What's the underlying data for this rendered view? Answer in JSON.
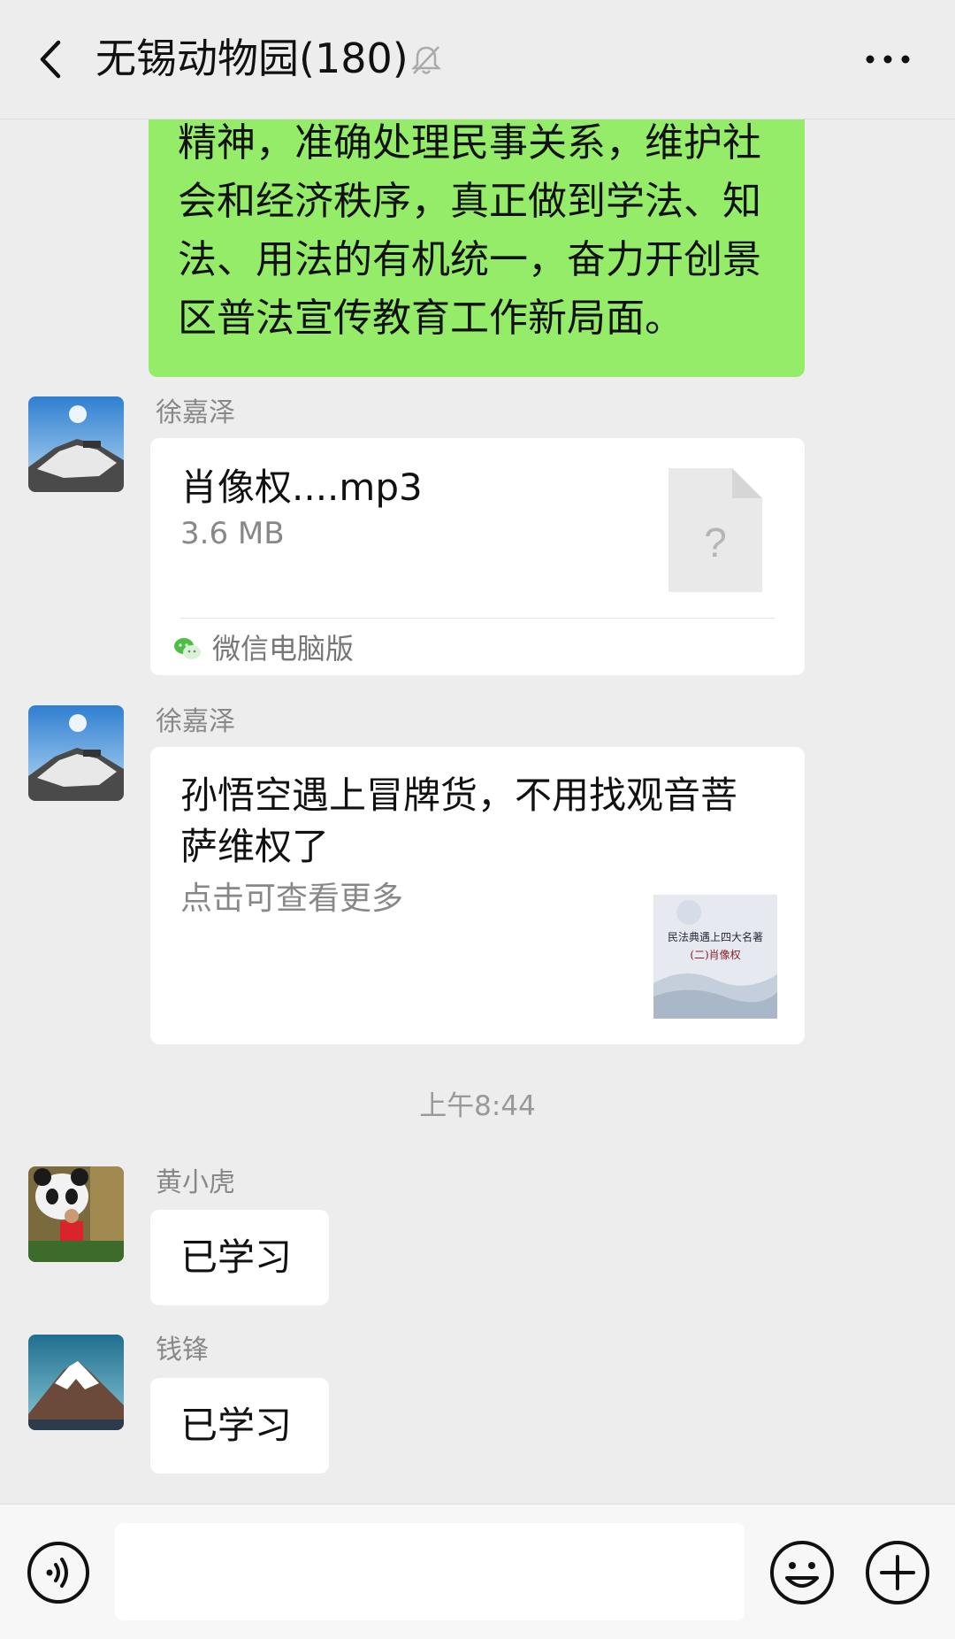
{
  "header": {
    "title": "无锡动物园(180)",
    "back_icon": "chevron-left-icon",
    "mute_icon": "bell-muted-icon",
    "more_icon": "more-dots-icon"
  },
  "messages": {
    "own_text": "精神，准确处理民事关系，维护社会和经济秩序，真正做到学法、知法、用法的有机统一，奋力开创景区普法宣传教育工作新局面。",
    "file_message": {
      "sender": "徐嘉泽",
      "file_name": "肖像权....mp3",
      "file_size": "3.6 MB",
      "file_icon_glyph": "?",
      "source": "微信电脑版"
    },
    "link_message": {
      "sender": "徐嘉泽",
      "title": "孙悟空遇上冒牌货，不用找观音菩萨维权了",
      "description": "点击可查看更多",
      "thumb_text_line1": "民法典遇上四大名著",
      "thumb_text_line2": "(二)肖像权"
    },
    "timestamp": "上午8:44",
    "reply1": {
      "sender": "黄小虎",
      "text": "已学习"
    },
    "reply2": {
      "sender": "钱锋",
      "text": "已学习"
    }
  },
  "input_bar": {
    "voice_icon": "voice-icon",
    "emoji_icon": "emoji-icon",
    "plus_icon": "plus-icon",
    "input_value": ""
  },
  "colors": {
    "background": "#ededed",
    "own_bubble": "#95ec69",
    "other_bubble": "#ffffff",
    "secondary_text": "#888888"
  }
}
